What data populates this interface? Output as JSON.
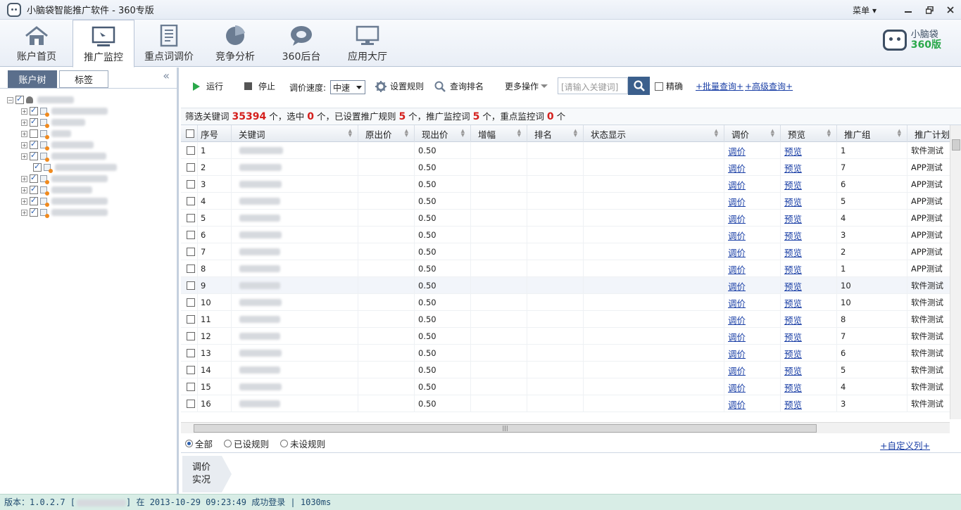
{
  "window": {
    "title": "小脑袋智能推广软件 - 360专版",
    "menu_label": "菜单",
    "minimize": "▭",
    "restore": "❐",
    "close": "✕"
  },
  "nav_tabs": [
    {
      "label": "账户首页",
      "icon": "home-icon"
    },
    {
      "label": "推广监控",
      "icon": "monitor-icon"
    },
    {
      "label": "重点词调价",
      "icon": "document-icon"
    },
    {
      "label": "竞争分析",
      "icon": "pie-chart-icon"
    },
    {
      "label": "360后台",
      "icon": "chat-bubble-icon"
    },
    {
      "label": "应用大厅",
      "icon": "computer-icon"
    }
  ],
  "brand": {
    "line1": "小脑袋",
    "line2": "360版"
  },
  "left_panel": {
    "tab_account_tree": "账户树",
    "tab_tags": "标签",
    "collapse": "«"
  },
  "toolbar": {
    "run": "运行",
    "stop": "停止",
    "speed_label": "调价速度:",
    "speed_value": "中速",
    "rules": "设置规则",
    "rank": "查询排名",
    "more": "更多操作",
    "search_placeholder": "[请输入关键词]",
    "exact": "精确",
    "batch_query": "+批量查询+",
    "advanced_query": "+高级查询+"
  },
  "filter": {
    "prefix": "筛选关键词",
    "total": "35394",
    "t1": "个，选中",
    "selected": "0",
    "t2": "个，已设置推广规则",
    "rules_count": "5",
    "t3": "个，推广监控词",
    "monitor_count": "5",
    "t4": "个，重点监控词",
    "key_count": "0",
    "t5": "个"
  },
  "table": {
    "headers": [
      "序号",
      "关键词",
      "原出价",
      "现出价",
      "增幅",
      "排名",
      "状态显示",
      "调价",
      "预览",
      "推广组",
      "推广计划"
    ],
    "rows": [
      {
        "no": "1",
        "bid": "0.50",
        "adjust": "调价",
        "preview": "预览",
        "group": "1",
        "plan": "软件测试"
      },
      {
        "no": "2",
        "bid": "0.50",
        "adjust": "调价",
        "preview": "预览",
        "group": "7",
        "plan": "APP测试"
      },
      {
        "no": "3",
        "bid": "0.50",
        "adjust": "调价",
        "preview": "预览",
        "group": "6",
        "plan": "APP测试"
      },
      {
        "no": "4",
        "bid": "0.50",
        "adjust": "调价",
        "preview": "预览",
        "group": "5",
        "plan": "APP测试"
      },
      {
        "no": "5",
        "bid": "0.50",
        "adjust": "调价",
        "preview": "预览",
        "group": "4",
        "plan": "APP测试"
      },
      {
        "no": "6",
        "bid": "0.50",
        "adjust": "调价",
        "preview": "预览",
        "group": "3",
        "plan": "APP测试"
      },
      {
        "no": "7",
        "bid": "0.50",
        "adjust": "调价",
        "preview": "预览",
        "group": "2",
        "plan": "APP测试"
      },
      {
        "no": "8",
        "bid": "0.50",
        "adjust": "调价",
        "preview": "预览",
        "group": "1",
        "plan": "APP测试"
      },
      {
        "no": "9",
        "bid": "0.50",
        "adjust": "调价",
        "preview": "预览",
        "group": "10",
        "plan": "软件测试"
      },
      {
        "no": "10",
        "bid": "0.50",
        "adjust": "调价",
        "preview": "预览",
        "group": "10",
        "plan": "软件测试"
      },
      {
        "no": "11",
        "bid": "0.50",
        "adjust": "调价",
        "preview": "预览",
        "group": "8",
        "plan": "软件测试"
      },
      {
        "no": "12",
        "bid": "0.50",
        "adjust": "调价",
        "preview": "预览",
        "group": "7",
        "plan": "软件测试"
      },
      {
        "no": "13",
        "bid": "0.50",
        "adjust": "调价",
        "preview": "预览",
        "group": "6",
        "plan": "软件测试"
      },
      {
        "no": "14",
        "bid": "0.50",
        "adjust": "调价",
        "preview": "预览",
        "group": "5",
        "plan": "软件测试"
      },
      {
        "no": "15",
        "bid": "0.50",
        "adjust": "调价",
        "preview": "预览",
        "group": "4",
        "plan": "软件测试"
      },
      {
        "no": "16",
        "bid": "0.50",
        "adjust": "调价",
        "preview": "预览",
        "group": "3",
        "plan": "软件测试"
      }
    ]
  },
  "radios": {
    "all": "全部",
    "set": "已设规则",
    "unset": "未设规则"
  },
  "custom_columns": "+自定义列+",
  "realtime": {
    "line1": "调价",
    "line2": "实况"
  },
  "status": {
    "version": "版本：1.0.2.7 [",
    "mid": "] 在 2013-10-29 09:23:49 成功登录 |  1030ms"
  }
}
